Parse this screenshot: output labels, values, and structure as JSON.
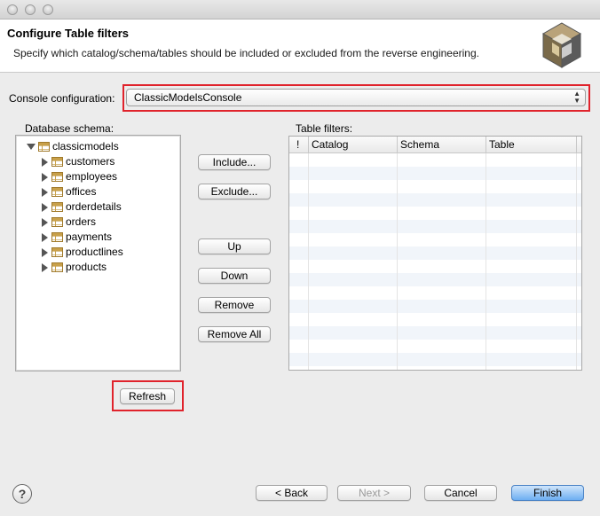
{
  "window": {
    "traffic_lights": [
      "close-icon",
      "minimize-icon",
      "zoom-icon"
    ]
  },
  "header": {
    "title": "Configure Table filters",
    "description": "Specify which catalog/schema/tables should be included or excluded from the reverse engineering."
  },
  "console": {
    "label": "Console configuration:",
    "selected": "ClassicModelsConsole"
  },
  "schema": {
    "label": "Database schema:",
    "root": "classicmodels",
    "tables": [
      "customers",
      "employees",
      "offices",
      "orderdetails",
      "orders",
      "payments",
      "productlines",
      "products"
    ]
  },
  "actions": {
    "include": "Include...",
    "exclude": "Exclude...",
    "up": "Up",
    "down": "Down",
    "remove": "Remove",
    "remove_all": "Remove All",
    "refresh": "Refresh"
  },
  "filters": {
    "label": "Table filters:",
    "columns": [
      "!",
      "Catalog",
      "Schema",
      "Table"
    ],
    "rows": []
  },
  "footer": {
    "help": "?",
    "back": "< Back",
    "next": "Next >",
    "cancel": "Cancel",
    "finish": "Finish"
  },
  "colors": {
    "highlight": "#e0232c",
    "primary_button": "#6daef2",
    "alt_row": "#f1f5fa"
  }
}
